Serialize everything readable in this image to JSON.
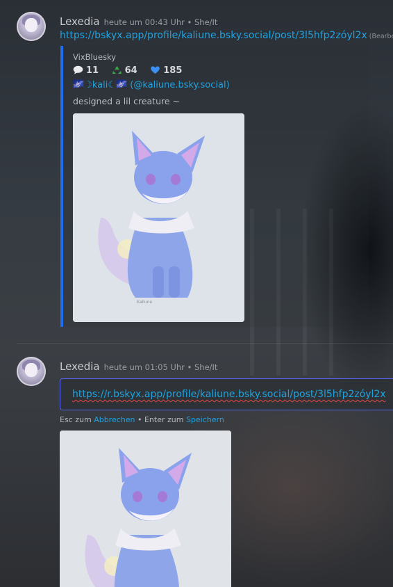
{
  "messages": [
    {
      "username": "Lexedia",
      "timestamp": "heute um 00:43 Uhr",
      "pronouns": "She/It",
      "link": "https://bskyx.app/profile/kaliune.bsky.social/post/3l5hfp2zóyl2x",
      "edited_label": "(Bearbei",
      "embed": {
        "author": "VixBluesky",
        "stats": [
          {
            "icon": "speech-bubble-icon",
            "value": "11"
          },
          {
            "icon": "recycle-icon",
            "value": "64"
          },
          {
            "icon": "blue-heart-icon",
            "value": "185"
          }
        ],
        "title": "🌌☽kali☾🌌 (@kaliune.bsky.social)",
        "description": "designed a lil creature ~",
        "image_alt": "blue fox creature drawing",
        "image_signature": "Kaliune"
      }
    },
    {
      "username": "Lexedia",
      "timestamp": "heute um 01:05 Uhr",
      "pronouns": "She/It",
      "edit_value": "https://r.bskyx.app/profile/kaliune.bsky.social/post/3l5hfp2zóyl2x",
      "hint_prefix": "Esc zum",
      "hint_cancel": "Abbrechen",
      "hint_mid": "• Enter zum",
      "hint_save": "Speichern"
    }
  ],
  "colors": {
    "link": "#1fa3e0",
    "embed_border": "#1d6ff0",
    "edit_border": "#5865f2",
    "spellcheck": "#e24545"
  }
}
